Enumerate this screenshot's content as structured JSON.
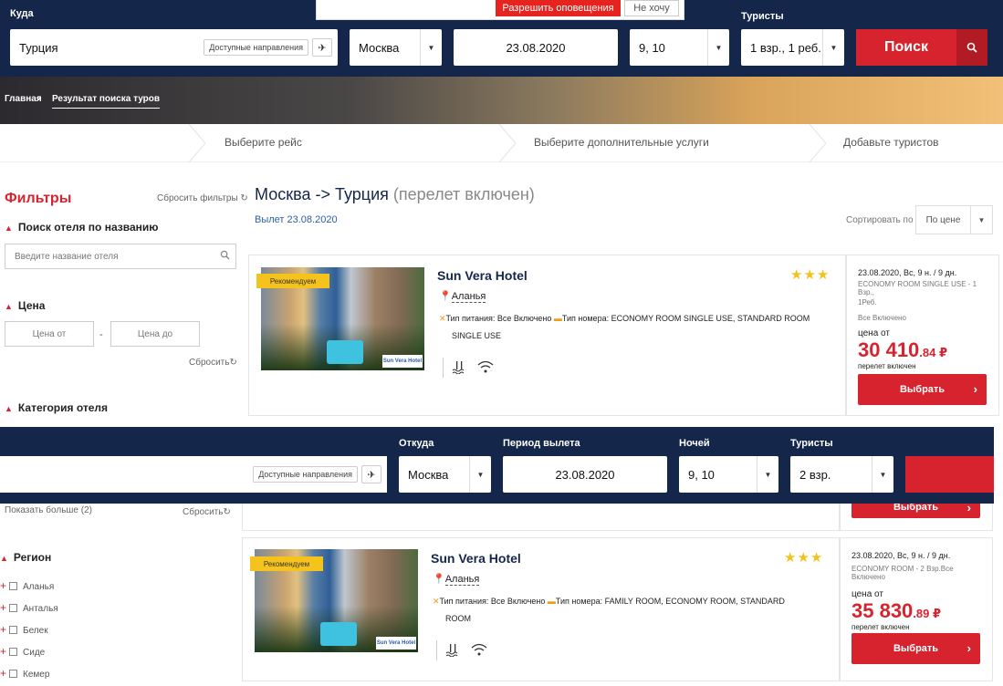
{
  "notification": {
    "allow": "Разрешить оповещения",
    "deny": "Не хочу"
  },
  "search": {
    "to_label": "Куда",
    "to_value": "Турция",
    "directions_chip": "Доступные направления",
    "from_value": "Москва",
    "date_value": "23.08.2020",
    "nights_value": "9, 10",
    "tourists_label": "Туристы",
    "tourists_value": "1 взр., 1 реб.",
    "search_button": "Поиск"
  },
  "breadcrumb": {
    "home": "Главная",
    "current": "Результат поиска туров"
  },
  "steps": [
    "Выберите рейс",
    "Выберите дополнительные услуги",
    "Добавьте туристов"
  ],
  "filters": {
    "title": "Фильтры",
    "reset_all": "Сбросить фильтры",
    "name_section": "Поиск отеля по названию",
    "name_placeholder": "Введите название отеля",
    "price_section": "Цена",
    "price_from": "Цена от",
    "price_to": "Цена до",
    "price_dash": "-",
    "reset": "Сбросить",
    "category_section": "Категория отеля",
    "show_more": "Показать больше (2)",
    "region_section": "Регион",
    "regions": [
      "Аланья",
      "Анталья",
      "Белек",
      "Сиде",
      "Кемер"
    ]
  },
  "results": {
    "route": "Москва -> Турция",
    "route_note": "(перелет включен)",
    "departure": "Вылет 23.08.2020",
    "sort_label": "Сортировать по",
    "sort_value": "По цене"
  },
  "hotels": [
    {
      "badge": "Рекомендуем",
      "name": "Sun Vera Hotel",
      "stars": "★★★",
      "location": "Аланья",
      "meal": "Тип питания: Все Включено",
      "room_line1": "Тип номера: ECONOMY ROOM SINGLE USE, STANDARD ROOM",
      "room_line2": "SINGLE USE",
      "logo_text": "Sun Vera Hotel",
      "date": "23.08.2020, Вс, 9 н. / 9 дн.",
      "room_short1": "ECONOMY ROOM SINGLE USE - 1 Взр.,",
      "room_short2": "1Реб.",
      "meal_short": "Все Включено",
      "price_from": "цена от",
      "price_main": "30 410",
      "price_cents": ".84 ₽",
      "price_note": "перелет включен",
      "select": "Выбрать"
    },
    {
      "badge": "Рекомендуем",
      "name": "Sun Vera Hotel",
      "stars": "★★★",
      "location": "Аланья",
      "meal": "Тип питания: Все Включено",
      "room_line1": "Тип номера: FAMILY ROOM, ECONOMY ROOM, STANDARD",
      "room_line2": "ROOM",
      "logo_text": "Sun Vera Hotel",
      "date": "23.08.2020, Вс, 9 н. / 9 дн.",
      "room_short1": "ECONOMY ROOM - 2 Взр.Все Включено",
      "price_from": "цена от",
      "price_main": "35 830",
      "price_cents": ".89 ₽",
      "price_note": "перелет включен",
      "select": "Выбрать"
    }
  ],
  "sticky": {
    "from_label": "Откуда",
    "period_label": "Период вылета",
    "nights_label": "Ночей",
    "tourists_label": "Туристы",
    "directions_chip": "Доступные направления",
    "from_value": "Москва",
    "date_value": "23.08.2020",
    "nights_value": "9, 10",
    "tourists_value": "2 взр.",
    "hidden_select": "Выбрать"
  }
}
